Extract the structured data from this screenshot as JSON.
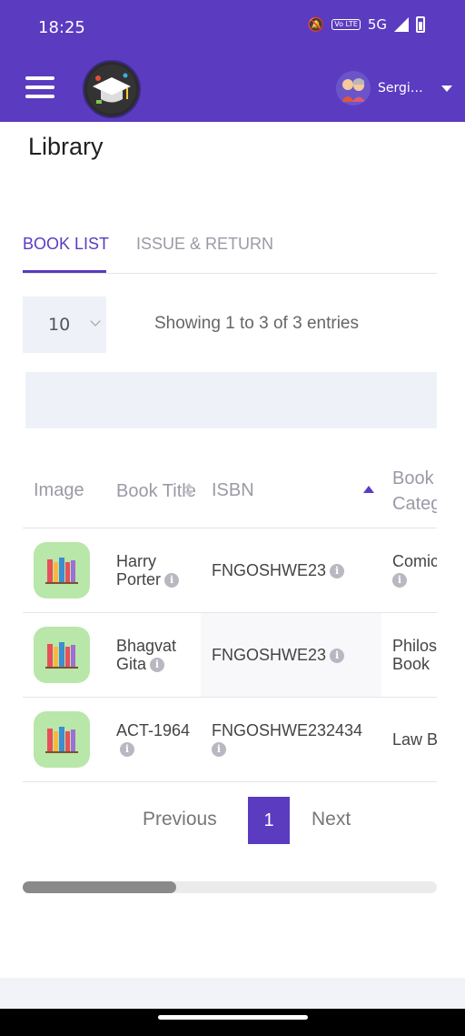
{
  "status_bar": {
    "time": "18:25",
    "network": "5G",
    "volte": "Vo LTE"
  },
  "header": {
    "user_name": "Sergio...",
    "icons": [
      "menu-icon",
      "app-logo",
      "user-avatar",
      "caret-down-icon"
    ]
  },
  "page": {
    "title": "Library"
  },
  "tabs": [
    {
      "label": "BOOK LIST",
      "active": true
    },
    {
      "label": "ISSUE & RETURN",
      "active": false
    }
  ],
  "controls": {
    "page_size": "10",
    "entries_info": "Showing 1 to 3 of 3 entries",
    "search_value": ""
  },
  "table": {
    "columns": [
      {
        "label": "Image"
      },
      {
        "label": "Book Title",
        "sort": "none"
      },
      {
        "label": "ISBN",
        "sort": "ascending"
      },
      {
        "label": "Book Category"
      }
    ],
    "rows": [
      {
        "title": "Harry Porter",
        "isbn": "FNGOSHWE23",
        "category": "Comics"
      },
      {
        "title": "Bhagvat Gita",
        "isbn": "FNGOSHWE23",
        "category": "Philosophy Book"
      },
      {
        "title": "ACT-1964",
        "isbn": "FNGOSHWE232434",
        "category": "Law Book"
      }
    ]
  },
  "pagination": {
    "previous": "Previous",
    "current": "1",
    "next": "Next"
  },
  "colors": {
    "primary": "#5b3bc0",
    "thumb_bg": "#b9e6a9",
    "input_bg": "#eef1f8"
  }
}
